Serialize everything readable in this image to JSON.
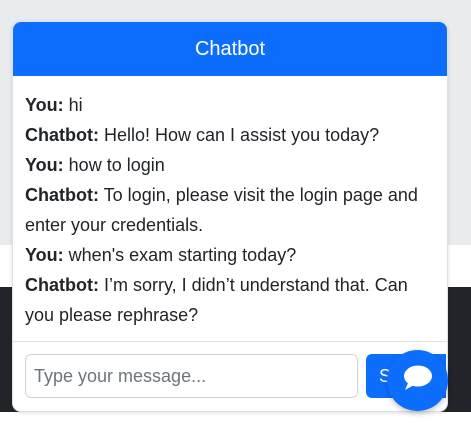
{
  "chatbot": {
    "title": "Chatbot",
    "messages": [
      {
        "speaker": "You:",
        "text": "hi"
      },
      {
        "speaker": "Chatbot:",
        "text": "Hello! How can I assist you today?"
      },
      {
        "speaker": "You:",
        "text": "how to login"
      },
      {
        "speaker": "Chatbot:",
        "text": "To login, please visit the login page and enter your credentials."
      },
      {
        "speaker": "You:",
        "text": "when's exam starting today?"
      },
      {
        "speaker": "Chatbot:",
        "text": "I’m sorry, I didn’t understand that. Can you please rephrase?"
      }
    ],
    "input": {
      "placeholder": "Type your message...",
      "value": ""
    },
    "send_label": "Send",
    "toggle_icon": "chat-bubble-icon"
  },
  "colors": {
    "primary": "#0d6efd",
    "page_background": "#e9ecef",
    "dark_section": "#212529"
  }
}
